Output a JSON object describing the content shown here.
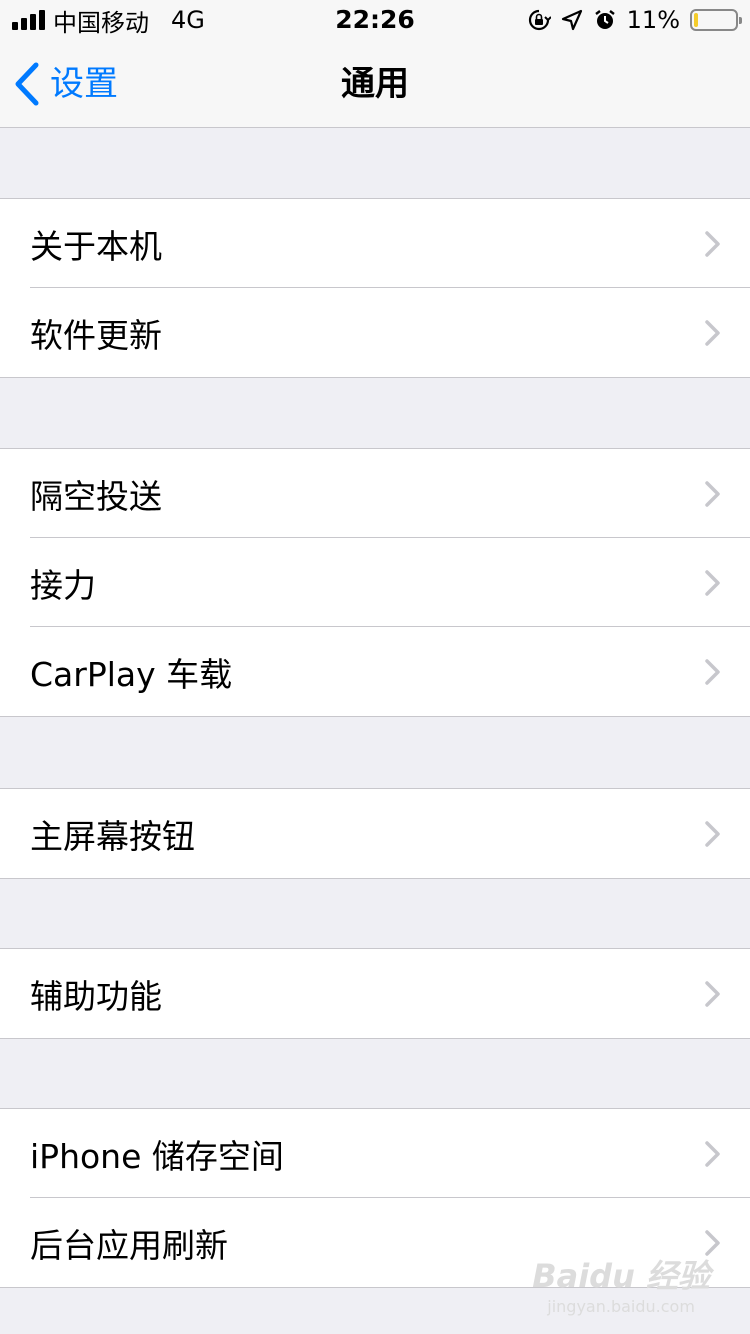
{
  "status_bar": {
    "carrier": "中国移动",
    "network": "4G",
    "time": "22:26",
    "battery_text": "11%",
    "battery_level": 0.11,
    "icons": [
      "orientation-lock-icon",
      "location-arrow-icon",
      "alarm-icon"
    ]
  },
  "nav": {
    "back_label": "设置",
    "title": "通用"
  },
  "groups": [
    {
      "items": [
        "关于本机",
        "软件更新"
      ]
    },
    {
      "items": [
        "隔空投送",
        "接力",
        "CarPlay 车载"
      ]
    },
    {
      "items": [
        "主屏幕按钮"
      ]
    },
    {
      "items": [
        "辅助功能"
      ]
    },
    {
      "items": [
        "iPhone 储存空间",
        "后台应用刷新"
      ]
    }
  ],
  "watermark": {
    "logo": "Baidu 经验",
    "url": "jingyan.baidu.com"
  },
  "colors": {
    "accent": "#007aff",
    "background": "#efeff4",
    "separator": "#c8c7cc",
    "chevron": "#c7c7cc",
    "battery": "#f4cc2b"
  }
}
